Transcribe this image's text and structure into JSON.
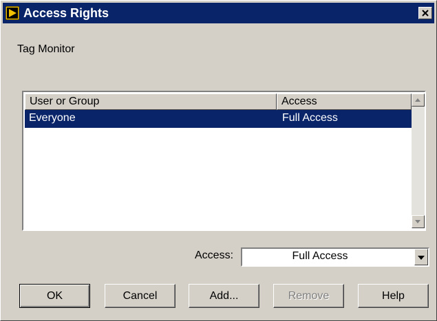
{
  "window": {
    "title": "Access Rights",
    "close_glyph": "×",
    "app_icon": "labview-play-icon"
  },
  "subtitle": "Tag Monitor",
  "list": {
    "columns": [
      "User or Group",
      "Access"
    ],
    "rows": [
      {
        "user": "Everyone",
        "access": "Full Access",
        "selected": true
      }
    ]
  },
  "access_field": {
    "label": "Access:",
    "value": "Full Access"
  },
  "buttons": {
    "ok": "OK",
    "cancel": "Cancel",
    "add": "Add...",
    "remove": "Remove",
    "help": "Help"
  },
  "colors": {
    "titlebar": "#0a246a",
    "face": "#d4d0c8",
    "selection": "#0a246a"
  }
}
